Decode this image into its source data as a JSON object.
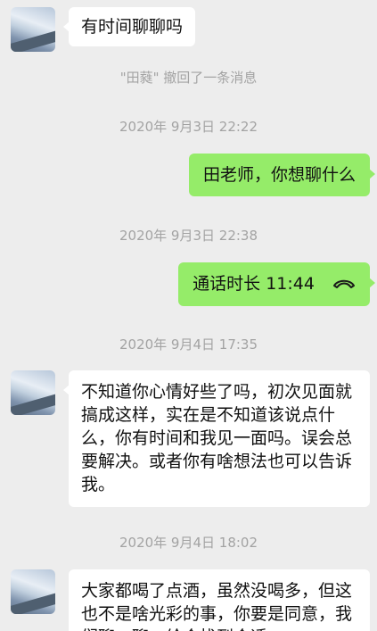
{
  "messages": {
    "m1": "有时间聊聊吗",
    "recall_notice": "\"田蕤\" 撤回了一条消息",
    "ts1": "2020年 9月3日 22:22",
    "m2": "田老师，你想聊什么",
    "ts2": "2020年 9月3日 22:38",
    "call_label": "通话时长 11:44",
    "ts3": "2020年 9月4日 17:35",
    "m3": "不知道你心情好些了吗，初次见面就搞成这样，实在是不知道该说点什么，你有时间和我见一面吗。误会总要解决。或者你有啥想法也可以告诉我。",
    "ts4": "2020年 9月4日 18:02",
    "m4": "大家都喝了点酒，虽然没喝多，但这也不是啥光彩的事，你要是同意，我们聊一聊，给个找到合适"
  },
  "icons": {
    "call": "phone-hangup-icon",
    "avatar": "sky-avatar"
  },
  "colors": {
    "background": "#ededed",
    "incoming": "#ffffff",
    "outgoing": "#95ec69",
    "meta_text": "#a3a3a3"
  }
}
